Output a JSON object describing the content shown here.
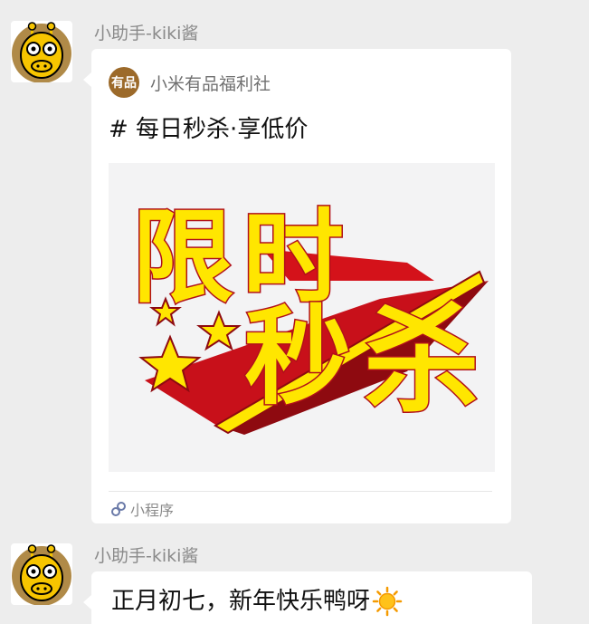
{
  "messages": [
    {
      "sender": "小助手-kiki酱",
      "avatar_icon": "giraffe-avatar-icon",
      "type": "mini_program_card",
      "card": {
        "logo_text": "有品",
        "source": "小米有品福利社",
        "title": "# 每日秒杀·享低价",
        "image_text": {
          "line1": [
            "限",
            "时"
          ],
          "line2": [
            "秒",
            "杀"
          ]
        },
        "footer_label": "小程序",
        "footer_icon": "mini-program-icon"
      }
    },
    {
      "sender": "小助手-kiki酱",
      "avatar_icon": "giraffe-avatar-icon",
      "type": "text",
      "text": "正月初七，新年快乐鸭呀",
      "emoji": "sun-icon"
    }
  ],
  "colors": {
    "background": "#ededed",
    "bubble": "#ffffff",
    "promo_red": "#d4121a",
    "promo_yellow": "#ffe600",
    "logo_brown": "#9c6a2a"
  }
}
